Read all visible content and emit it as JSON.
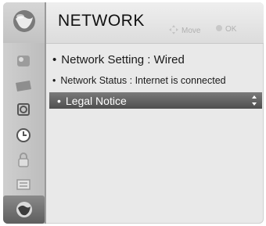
{
  "menu": {
    "title": "NETWORK",
    "hints": {
      "move_label": "Move",
      "ok_label": "OK"
    }
  },
  "items": [
    {
      "bullet": "•",
      "label": "Network Setting  : Wired"
    },
    {
      "bullet": "•",
      "label": "Network Status  : Internet is connected"
    },
    {
      "bullet": "•",
      "label": "Legal Notice"
    }
  ],
  "sidebar": {
    "icons": [
      "network-globe-icon",
      "picture-icon",
      "screen-icon",
      "audio-icon",
      "time-icon",
      "lock-icon",
      "option-icon",
      "network-icon"
    ],
    "active": "network-icon"
  },
  "colors": {
    "highlight": "#5e5e5e",
    "panel": "#e9e9e9",
    "hint_text": "#b0b0b0"
  }
}
